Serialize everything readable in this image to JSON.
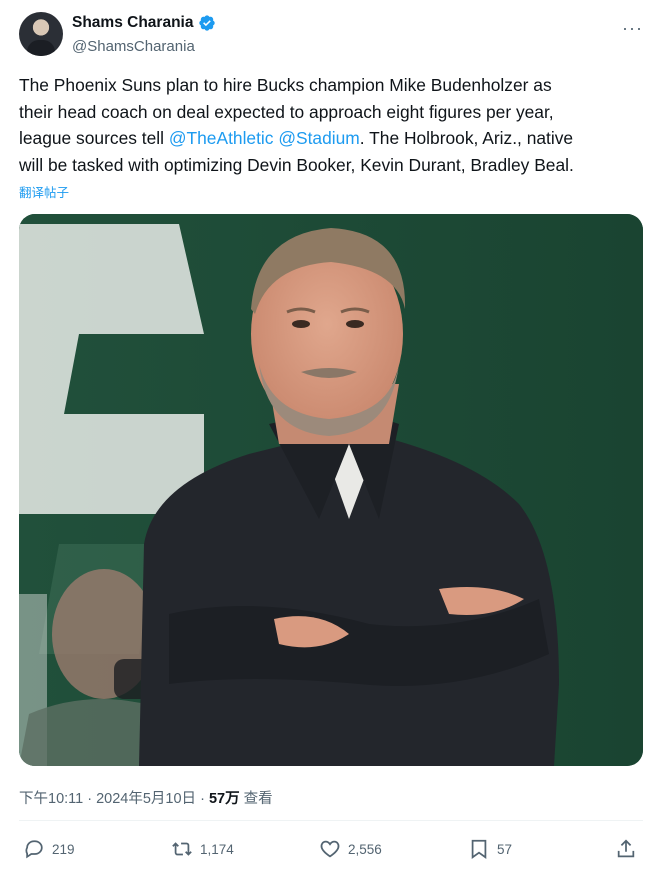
{
  "author": {
    "name": "Shams Charania",
    "handle": "@ShamsCharania",
    "verified": true
  },
  "tweet": {
    "line1": "The Phoenix Suns plan to hire Bucks champion Mike Budenholzer as",
    "line2": "their head coach on deal expected to approach eight figures per year,",
    "line3_prefix": "league sources tell ",
    "mention1": "@TheAthletic",
    "mention2": "@Stadium",
    "line3_suffix": ". The Holbrook, Ariz., native",
    "line4": "will be tasked with optimizing Devin Booker, Kevin Durant, Bradley Beal.",
    "translate_label": "翻译帖子"
  },
  "meta": {
    "time": "下午10:11",
    "date": "2024年5月10日",
    "views_count": "57万",
    "views_label": "查看"
  },
  "actions": {
    "replies": "219",
    "reposts": "1,174",
    "likes": "2,556",
    "bookmarks": "57"
  },
  "colors": {
    "link": "#1d9bf0",
    "secondary_text": "#536471",
    "court_green": "#1e4a37"
  },
  "icons": [
    "verified-badge-icon",
    "more-icon",
    "reply-icon",
    "repost-icon",
    "like-icon",
    "bookmark-icon",
    "share-icon"
  ]
}
